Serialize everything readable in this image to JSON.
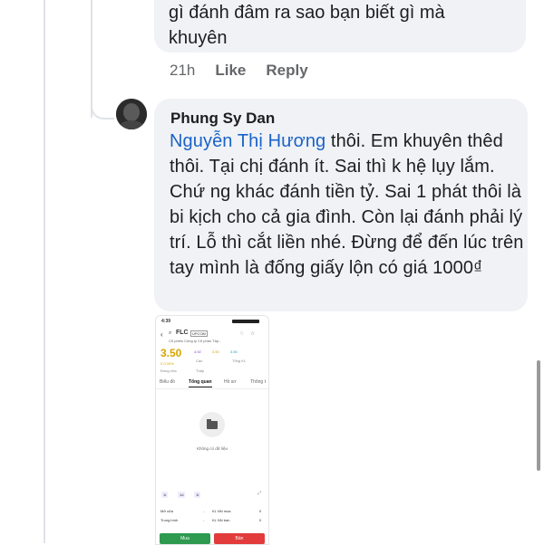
{
  "previous_comment": {
    "text_line1": "gì đánh đâm ra sao bạn biết gì mà",
    "text_line2": "khuyên",
    "time": "21h",
    "like_label": "Like",
    "reply_label": "Reply"
  },
  "comment": {
    "author": "Phung Sy Dan",
    "mention": "Nguyễn Thị Hương",
    "text": " thôi. Em khuyên thêd thôi. Tại chị đánh ít. Sai thì k hệ lụy lắm. Chứ ng khác đánh tiền tỷ. Sai 1 phát thôi là bi kịch cho cả gia đình. Còn lại đánh phải lý trí. Lỗ thì cắt liền nhé. Đừng để đến lúc trên tay mình là đống giấy lộn có giá 1000₫"
  },
  "attachment": {
    "status_time": "4:39",
    "ticker": "FLC",
    "exchange_badge": "UPCOM",
    "company": "Cổ phiếu Công ty Cổ phần Tập...",
    "price": "3.50",
    "price_change": "0 0.00%",
    "stat1": "4.92",
    "stat2": "3.50",
    "stat3": "3.50",
    "stat1_label": "Cao",
    "stat2_label": "Tổng KL",
    "low_label": "Thấp",
    "ref_label": "Đóng cửa",
    "tabs": [
      "Biểu đồ",
      "Tổng quan",
      "Hồ sơ",
      "Thông t"
    ],
    "active_tab": "Tổng quan",
    "empty_text": "Không có dữ liệu",
    "chip1": "1t",
    "chip2": "1d",
    "chip3": "1t",
    "row1_left": "Mở cửa",
    "row1_mid": "KL NN mua",
    "row1_val": "0",
    "row2_left": "Trung bình",
    "row2_mid": "KL NN bán",
    "row2_val": "0",
    "dash": "-",
    "buy_label": "Mua",
    "sell_label": "Bán",
    "buy_color": "#2e9a4f",
    "sell_color": "#e23b3b"
  },
  "colors": {
    "bubble": "#f0f2f5",
    "mention": "#1a63c9",
    "meta": "#65676b"
  }
}
